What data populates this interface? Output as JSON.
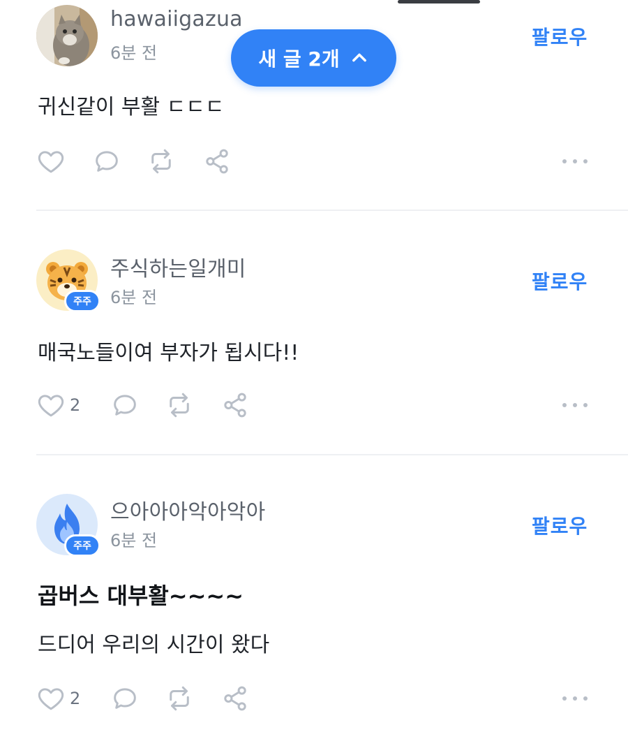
{
  "new_posts_pill": {
    "label": "새 글 2개"
  },
  "posts": [
    {
      "username": "hawaiigazua",
      "time": "6분 전",
      "follow_label": "팔로우",
      "title": "",
      "text": "귀신같이 부활 ㄷㄷㄷ",
      "like_count": "",
      "badge": ""
    },
    {
      "username": "주식하는일개미",
      "time": "6분 전",
      "follow_label": "팔로우",
      "title": "",
      "text": "매국노들이여 부자가 됩시다!!",
      "like_count": "2",
      "badge": "주주"
    },
    {
      "username": "으아아아악아악아",
      "time": "6분 전",
      "follow_label": "팔로우",
      "title": "곱버스 대부활~~~~",
      "text": "드디어 우리의 시간이 왔다",
      "like_count": "2",
      "badge": "주주"
    }
  ],
  "icons": {
    "like": "heart-outline",
    "comment": "speech-bubble",
    "repost": "repeat-arrows",
    "share": "share-nodes",
    "more": "three-dots",
    "collapse": "chevron-up"
  },
  "colors": {
    "accent": "#3182f6",
    "icon_gray": "#b8bec7",
    "text_primary": "#1f2329",
    "text_secondary": "#8b949e"
  }
}
